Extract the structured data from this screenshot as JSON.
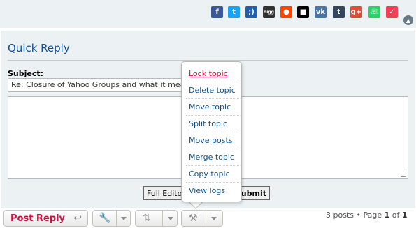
{
  "share_icons": [
    {
      "icon": "facebook-icon",
      "glyph": "f",
      "color": "#3b5998"
    },
    {
      "icon": "twitter-icon",
      "glyph": "t",
      "color": "#1da1f2"
    },
    {
      "icon": "myspace-icon",
      "glyph": ";)",
      "color": "#1f5fad"
    },
    {
      "icon": "digg-icon",
      "glyph": "digg",
      "color": "#333333"
    },
    {
      "icon": "reddit-icon",
      "glyph": "●",
      "color": "#ff4500"
    },
    {
      "icon": "delicious-icon",
      "glyph": "■",
      "color": "#000000"
    },
    {
      "icon": "vk-icon",
      "glyph": "vk",
      "color": "#4c75a3"
    },
    {
      "icon": "tumblr-icon",
      "glyph": "t",
      "color": "#35465c"
    },
    {
      "icon": "google-plus-icon",
      "glyph": "g+",
      "color": "#dd4b39"
    },
    {
      "icon": "whatsapp-icon",
      "glyph": "☏",
      "color": "#25d366"
    },
    {
      "icon": "pocket-icon",
      "glyph": "✓",
      "color": "#ef4056"
    }
  ],
  "quick_reply": {
    "title": "Quick Reply",
    "subject_label": "Subject:",
    "subject_value": "Re: Closure of Yahoo Groups and what it means",
    "full_editor_label": "Full Editor & Preview",
    "submit_label": "Submit"
  },
  "toolbar": {
    "post_reply_label": "Post Reply"
  },
  "pagination": {
    "prefix": "3 posts • Page",
    "current": "1",
    "of": "of",
    "total": "1"
  },
  "topic_tools_menu": {
    "items": [
      {
        "label": "Lock topic",
        "hover": true
      },
      {
        "label": "Delete topic"
      },
      {
        "label": "Move topic"
      },
      {
        "label": "Split topic"
      },
      {
        "label": "Move posts"
      },
      {
        "label": "Merge topic"
      },
      {
        "label": "Copy topic"
      },
      {
        "label": "View logs"
      }
    ]
  },
  "colors": {
    "link": "#105289",
    "accent_red": "#d31141",
    "panel_bg": "#ecf1f3"
  }
}
